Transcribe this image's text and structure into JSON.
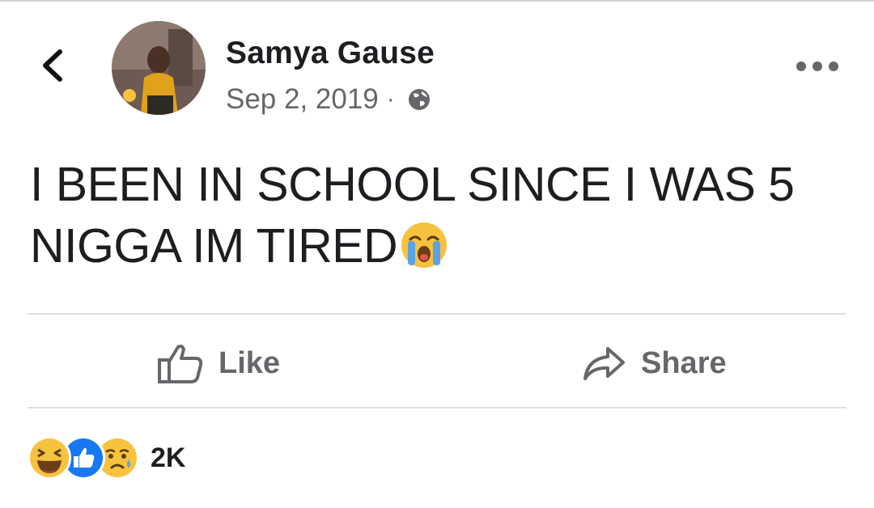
{
  "post": {
    "author": "Samya Gause",
    "date": "Sep 2, 2019",
    "separator": "·",
    "privacy_icon": "globe-icon",
    "text_line_1": "I BEEN IN SCHOOL SINCE I WAS 5",
    "text_line_2": "NIGGA IM TIRED",
    "text_emoji": "loudly-crying-face-emoji"
  },
  "actions": {
    "like_label": "Like",
    "share_label": "Share"
  },
  "reactions": {
    "icons": [
      "haha-reaction-icon",
      "like-reaction-icon",
      "sad-reaction-icon"
    ],
    "count": "2K"
  },
  "colors": {
    "text": "#1c1e21",
    "secondary": "#65676b",
    "divider": "#dddfe2",
    "like_blue": "#1877f2",
    "emoji_yellow": "#f7c23e"
  }
}
